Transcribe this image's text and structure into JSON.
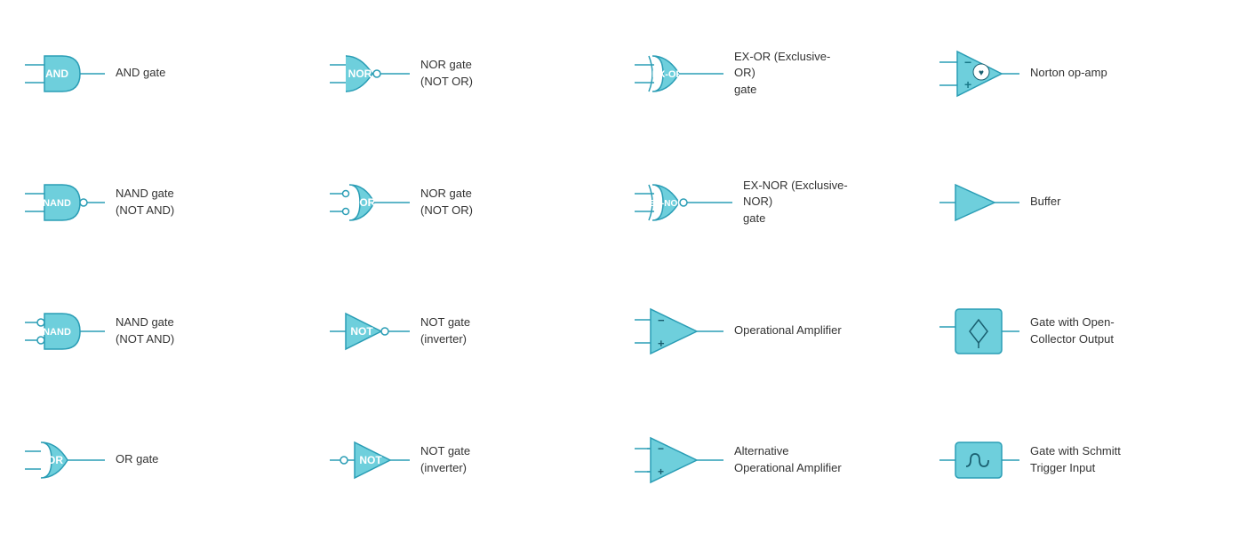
{
  "components": [
    {
      "id": "and-gate",
      "label": "AND gate",
      "row": 0,
      "col": 0
    },
    {
      "id": "nor-gate-1",
      "label": "NOR gate\n(NOT OR)",
      "row": 0,
      "col": 1
    },
    {
      "id": "ex-or-gate",
      "label": "EX-OR (Exclusive-OR)\ngate",
      "row": 0,
      "col": 2
    },
    {
      "id": "norton-opamp",
      "label": "Norton op-amp",
      "row": 0,
      "col": 3
    },
    {
      "id": "nand-gate-1",
      "label": "NAND gate\n(NOT AND)",
      "row": 1,
      "col": 0
    },
    {
      "id": "nor-gate-2",
      "label": "NOR gate\n(NOT OR)",
      "row": 1,
      "col": 1
    },
    {
      "id": "ex-nor-gate",
      "label": "EX-NOR (Exclusive-NOR)\ngate",
      "row": 1,
      "col": 2
    },
    {
      "id": "buffer",
      "label": "Buffer",
      "row": 1,
      "col": 3
    },
    {
      "id": "nand-gate-2",
      "label": "NAND gate\n(NOT AND)",
      "row": 2,
      "col": 0
    },
    {
      "id": "not-gate-1",
      "label": "NOT gate\n(inverter)",
      "row": 2,
      "col": 1
    },
    {
      "id": "op-amp",
      "label": "Operational Amplifier",
      "row": 2,
      "col": 2
    },
    {
      "id": "open-collector",
      "label": "Gate with Open-\nCollector Output",
      "row": 2,
      "col": 3
    },
    {
      "id": "or-gate",
      "label": "OR gate",
      "row": 3,
      "col": 0
    },
    {
      "id": "not-gate-2",
      "label": "NOT gate\n(inverter)",
      "row": 3,
      "col": 1
    },
    {
      "id": "alt-op-amp",
      "label": "Alternative\nOperational Amplifier",
      "row": 3,
      "col": 2
    },
    {
      "id": "schmitt-trigger",
      "label": "Gate with Schmitt\nTrigger Input",
      "row": 3,
      "col": 3
    }
  ]
}
